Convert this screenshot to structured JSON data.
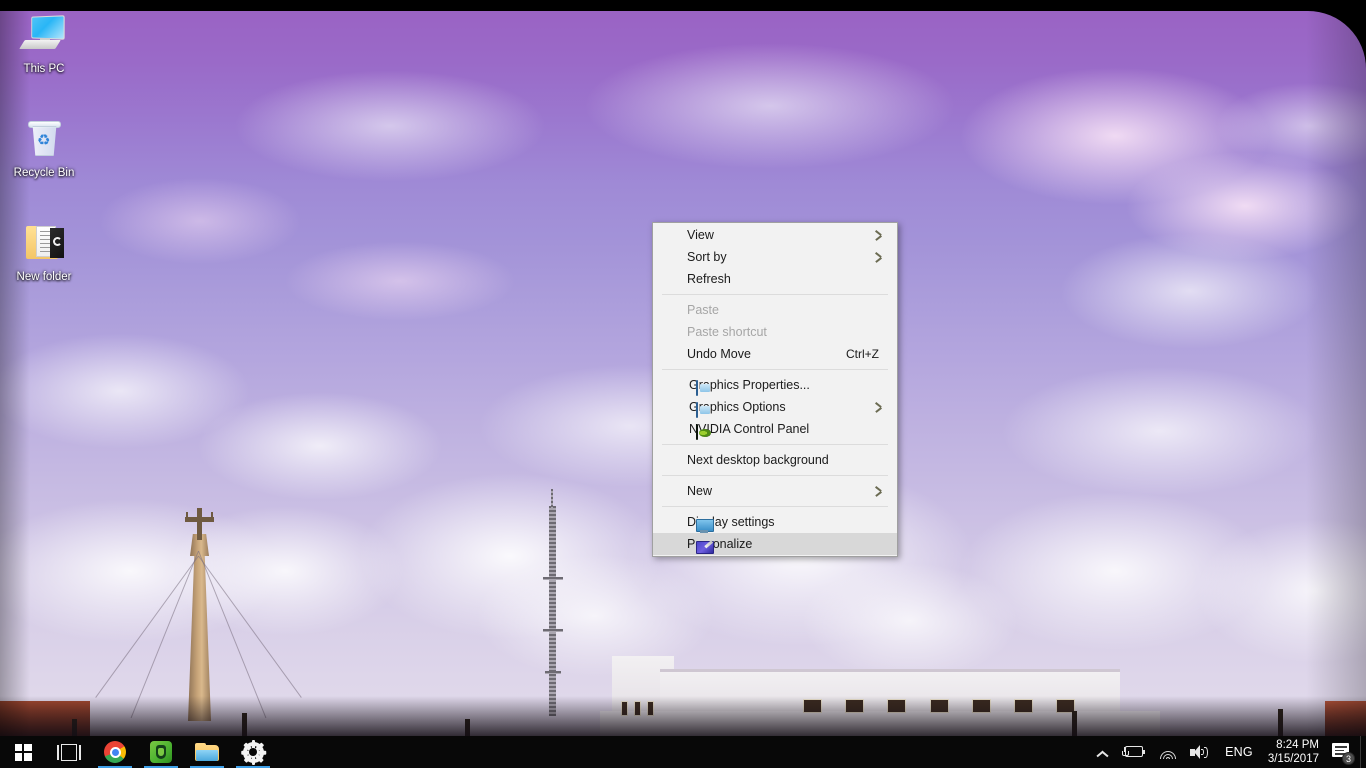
{
  "desktop": {
    "icons": [
      {
        "label": "This PC",
        "icon": "computer-icon"
      },
      {
        "label": "Recycle Bin",
        "icon": "recycle-bin-icon"
      },
      {
        "label": "New folder",
        "icon": "folder-icon"
      }
    ]
  },
  "context_menu": {
    "groups": [
      {
        "items": [
          {
            "label": "View",
            "icon": null,
            "submenu": true,
            "disabled": false,
            "highlight": false,
            "accel": ""
          },
          {
            "label": "Sort by",
            "icon": null,
            "submenu": true,
            "disabled": false,
            "highlight": false,
            "accel": ""
          },
          {
            "label": "Refresh",
            "icon": null,
            "submenu": false,
            "disabled": false,
            "highlight": false,
            "accel": ""
          }
        ]
      },
      {
        "items": [
          {
            "label": "Paste",
            "icon": null,
            "submenu": false,
            "disabled": true,
            "highlight": false,
            "accel": ""
          },
          {
            "label": "Paste shortcut",
            "icon": null,
            "submenu": false,
            "disabled": true,
            "highlight": false,
            "accel": ""
          },
          {
            "label": "Undo Move",
            "icon": null,
            "submenu": false,
            "disabled": false,
            "highlight": false,
            "accel": "Ctrl+Z"
          }
        ]
      },
      {
        "items": [
          {
            "label": "Graphics Properties...",
            "icon": "intel-graphics-icon",
            "submenu": false,
            "disabled": false,
            "highlight": false,
            "accel": ""
          },
          {
            "label": "Graphics Options",
            "icon": "intel-graphics-icon",
            "submenu": true,
            "disabled": false,
            "highlight": false,
            "accel": ""
          },
          {
            "label": "NVIDIA Control Panel",
            "icon": "nvidia-icon",
            "submenu": false,
            "disabled": false,
            "highlight": false,
            "accel": ""
          }
        ]
      },
      {
        "items": [
          {
            "label": "Next desktop background",
            "icon": null,
            "submenu": false,
            "disabled": false,
            "highlight": false,
            "accel": ""
          }
        ]
      },
      {
        "items": [
          {
            "label": "New",
            "icon": null,
            "submenu": true,
            "disabled": false,
            "highlight": false,
            "accel": ""
          }
        ]
      },
      {
        "items": [
          {
            "label": "Display settings",
            "icon": "display-icon",
            "submenu": false,
            "disabled": false,
            "highlight": false,
            "accel": ""
          },
          {
            "label": "Personalize",
            "icon": "personalize-icon",
            "submenu": false,
            "disabled": false,
            "highlight": true,
            "accel": ""
          }
        ]
      }
    ]
  },
  "taskbar": {
    "buttons": [
      {
        "name": "start-button",
        "icon": "windows-logo-icon",
        "running": false
      },
      {
        "name": "task-view-button",
        "icon": "task-view-icon",
        "running": false
      },
      {
        "name": "chrome-button",
        "icon": "chrome-icon",
        "running": true
      },
      {
        "name": "evernote-button",
        "icon": "evernote-icon",
        "running": true
      },
      {
        "name": "file-explorer-button",
        "icon": "folder-icon",
        "running": true
      },
      {
        "name": "settings-button",
        "icon": "gear-icon",
        "running": true
      }
    ],
    "tray": {
      "chevron": "show-hidden-icons-icon",
      "battery": "battery-charging-icon",
      "network": "wifi-icon",
      "volume": "speaker-icon",
      "language": "ENG",
      "time": "8:24 PM",
      "date": "3/15/2017",
      "notifications": "action-center-icon",
      "notification_count": "3"
    }
  },
  "colors": {
    "menu_bg": "#f2f2f2",
    "menu_highlight": "#d8d8d8",
    "menu_border": "#a0a0a0",
    "taskbar_bg": "#080808",
    "accent": "#3fa0e8",
    "sky_top": "#9a63c4",
    "sky_bottom": "#e2dbec"
  }
}
